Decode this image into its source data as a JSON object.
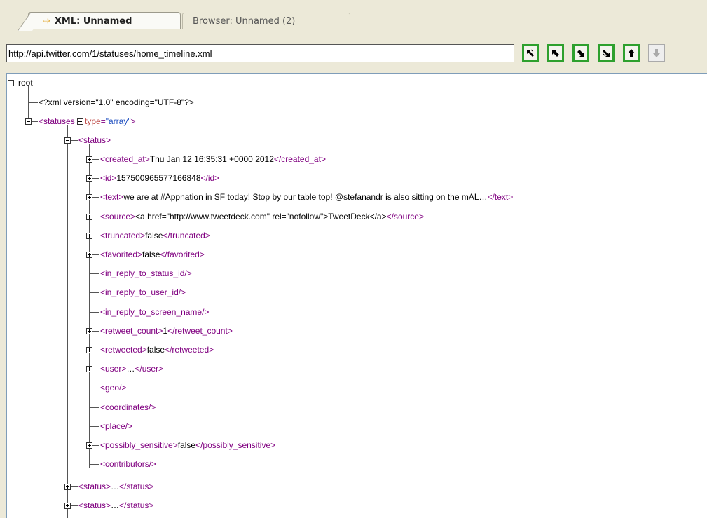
{
  "tabs": [
    {
      "label": "XML: Unnamed"
    },
    {
      "label": "Browser: Unnamed (2)"
    }
  ],
  "address": {
    "url": "http://api.twitter.com/1/statuses/home_timeline.xml"
  },
  "nav_buttons": [
    {
      "icon": "expand-all-icon"
    },
    {
      "icon": "arrow-up-left-icon"
    },
    {
      "icon": "arrow-down-right-icon"
    },
    {
      "icon": "collapse-all-icon"
    },
    {
      "icon": "arrow-up-icon"
    },
    {
      "icon": "arrow-down-icon"
    }
  ],
  "tree": {
    "root": "root",
    "decl": "<?xml version=\"1.0\" encoding=\"UTF-8\"?>",
    "statuses_open": "<statuses ",
    "statuses_attr": "type",
    "statuses_eq": "=",
    "statuses_val": "\"array\"",
    "statuses_close": ">",
    "status_open": "<status>",
    "rows": [
      {
        "o": "<created_at>",
        "v": "Thu Jan 12 16:35:31 +0000 2012",
        "c": "</created_at>"
      },
      {
        "o": "<id>",
        "v": "157500965577166848",
        "c": "</id>"
      },
      {
        "o": "<text>",
        "v": "we are at #Appnation in SF today! Stop by our table top! @stefanandr is also sitting on the mAL…",
        "c": "</text>"
      },
      {
        "o": "<source>",
        "v": "<a href=\"http://www.tweetdeck.com\" rel=\"nofollow\">TweetDeck</a>",
        "c": "</source>"
      },
      {
        "o": "<truncated>",
        "v": "false",
        "c": "</truncated>"
      },
      {
        "o": "<favorited>",
        "v": "false",
        "c": "</favorited>"
      },
      {
        "o": "<in_reply_to_status_id/>",
        "v": "",
        "c": ""
      },
      {
        "o": "<in_reply_to_user_id/>",
        "v": "",
        "c": ""
      },
      {
        "o": "<in_reply_to_screen_name/>",
        "v": "",
        "c": ""
      },
      {
        "o": "<retweet_count>",
        "v": "1",
        "c": "</retweet_count>"
      },
      {
        "o": "<retweeted>",
        "v": "false",
        "c": "</retweeted>"
      },
      {
        "o": "<user>",
        "v": "…",
        "c": "</user>"
      },
      {
        "o": "<geo/>",
        "v": "",
        "c": ""
      },
      {
        "o": "<coordinates/>",
        "v": "",
        "c": ""
      },
      {
        "o": "<place/>",
        "v": "",
        "c": ""
      },
      {
        "o": "<possibly_sensitive>",
        "v": "false",
        "c": "</possibly_sensitive>"
      },
      {
        "o": "<contributors/>",
        "v": "",
        "c": ""
      }
    ],
    "collapsed": [
      {
        "o": "<status>",
        "v": "…",
        "c": "</status>"
      },
      {
        "o": "<status>",
        "v": "…",
        "c": "</status>"
      }
    ]
  },
  "colors": {
    "tag": "#800080",
    "text": "#000000",
    "attribute": "#c0504d",
    "attribute_value": "#2050c0",
    "nav_border": "#2ea02e"
  }
}
